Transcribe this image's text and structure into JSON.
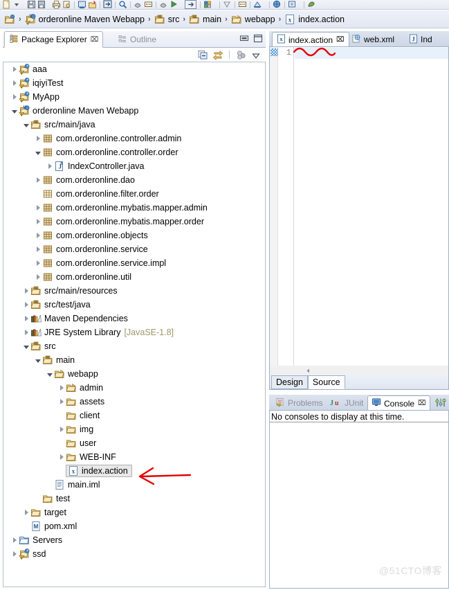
{
  "toolbar": {
    "icons": [
      "new-file-icon",
      "new-wizard-dropdown-icon",
      "save-icon",
      "save-dropdown-icon",
      "print-icon",
      "print-preview-icon",
      "build-all-icon",
      "search-icon",
      "debug-icon",
      "run-icon",
      "run-dropdown-icon",
      "external-tools-icon",
      "next-annotation-icon",
      "previous-annotation-icon",
      "open-type-icon",
      "open-task-icon",
      "perspective-icon",
      "new-java-project-icon",
      "toggle-breadcrumb-icon",
      "pin-editor-icon",
      "terminal-icon",
      "browser-icon",
      "snapshot-icon",
      "tomcat-icon"
    ]
  },
  "breadcrumb": {
    "items": [
      {
        "label": "",
        "icon": "workspace-root-icon"
      },
      {
        "label": "orderonline Maven Webapp",
        "icon": "maven-project-icon"
      },
      {
        "label": "src",
        "icon": "source-folder-icon"
      },
      {
        "label": "main",
        "icon": "source-folder-icon"
      },
      {
        "label": "webapp",
        "icon": "folder-icon"
      },
      {
        "label": "index.action",
        "icon": "xml-file-icon"
      }
    ],
    "separator": "›"
  },
  "package_explorer": {
    "tabs": [
      {
        "label": "Package Explorer",
        "icon": "package-explorer-icon",
        "active": true,
        "close": "⌧"
      },
      {
        "label": "Outline",
        "icon": "outline-icon",
        "active": false
      }
    ],
    "window_buttons": [
      {
        "name": "minimize-view-button",
        "glyph": "minimize"
      },
      {
        "name": "maximize-view-button",
        "glyph": "maximize"
      }
    ],
    "view_tools": [
      {
        "name": "collapse-all-icon"
      },
      {
        "name": "link-with-editor-icon"
      },
      {
        "name": "focus-on-active-task-icon"
      },
      {
        "name": "view-menu-icon"
      }
    ],
    "tree": [
      {
        "label": "aaa",
        "indent": 0,
        "arrow": "collapsed",
        "icon": "java-project-warning-icon"
      },
      {
        "label": "iqiyiTest",
        "indent": 0,
        "arrow": "collapsed",
        "icon": "java-project-warning-icon"
      },
      {
        "label": "MyApp",
        "indent": 0,
        "arrow": "collapsed",
        "icon": "java-project-warning-icon"
      },
      {
        "label": "orderonline Maven Webapp",
        "indent": 0,
        "arrow": "expanded",
        "icon": "maven-project-warning-icon"
      },
      {
        "label": "src/main/java",
        "indent": 1,
        "arrow": "expanded",
        "icon": "source-folder-icon"
      },
      {
        "label": "com.orderonline.controller.admin",
        "indent": 2,
        "arrow": "collapsed",
        "icon": "package-icon"
      },
      {
        "label": "com.orderonline.controller.order",
        "indent": 2,
        "arrow": "expanded",
        "icon": "package-icon"
      },
      {
        "label": "IndexController.java",
        "indent": 3,
        "arrow": "collapsed",
        "icon": "java-file-icon"
      },
      {
        "label": "com.orderonline.dao",
        "indent": 2,
        "arrow": "collapsed",
        "icon": "package-icon"
      },
      {
        "label": "com.orderonline.filter.order",
        "indent": 2,
        "arrow": "none",
        "icon": "package-empty-icon"
      },
      {
        "label": "com.orderonline.mybatis.mapper.admin",
        "indent": 2,
        "arrow": "collapsed",
        "icon": "package-icon"
      },
      {
        "label": "com.orderonline.mybatis.mapper.order",
        "indent": 2,
        "arrow": "collapsed",
        "icon": "package-icon"
      },
      {
        "label": "com.orderonline.objects",
        "indent": 2,
        "arrow": "collapsed",
        "icon": "package-icon"
      },
      {
        "label": "com.orderonline.service",
        "indent": 2,
        "arrow": "collapsed",
        "icon": "package-icon"
      },
      {
        "label": "com.orderonline.service.impl",
        "indent": 2,
        "arrow": "collapsed",
        "icon": "package-icon"
      },
      {
        "label": "com.orderonline.util",
        "indent": 2,
        "arrow": "collapsed",
        "icon": "package-icon"
      },
      {
        "label": "src/main/resources",
        "indent": 1,
        "arrow": "collapsed",
        "icon": "source-folder-icon"
      },
      {
        "label": "src/test/java",
        "indent": 1,
        "arrow": "collapsed",
        "icon": "source-folder-icon"
      },
      {
        "label": "Maven Dependencies",
        "indent": 1,
        "arrow": "collapsed",
        "icon": "library-icon"
      },
      {
        "label": "JRE System Library",
        "suffix": "[JavaSE-1.8]",
        "indent": 1,
        "arrow": "collapsed",
        "icon": "library-icon"
      },
      {
        "label": "src",
        "indent": 1,
        "arrow": "expanded",
        "icon": "source-folder-icon"
      },
      {
        "label": "main",
        "indent": 2,
        "arrow": "expanded",
        "icon": "source-folder-icon"
      },
      {
        "label": "webapp",
        "indent": 3,
        "arrow": "expanded",
        "icon": "folder-icon"
      },
      {
        "label": "admin",
        "indent": 4,
        "arrow": "collapsed",
        "icon": "folder-icon"
      },
      {
        "label": "assets",
        "indent": 4,
        "arrow": "collapsed",
        "icon": "folder-plain-icon"
      },
      {
        "label": "client",
        "indent": 4,
        "arrow": "none",
        "icon": "folder-plain-icon"
      },
      {
        "label": "img",
        "indent": 4,
        "arrow": "collapsed",
        "icon": "folder-plain-icon"
      },
      {
        "label": "user",
        "indent": 4,
        "arrow": "none",
        "icon": "folder-plain-icon"
      },
      {
        "label": "WEB-INF",
        "indent": 4,
        "arrow": "collapsed",
        "icon": "folder-plain-icon"
      },
      {
        "label": "index.action",
        "indent": 4,
        "arrow": "none",
        "icon": "xml-file-icon",
        "selected": true
      },
      {
        "label": "main.iml",
        "indent": 3,
        "arrow": "none",
        "icon": "text-file-icon"
      },
      {
        "label": "test",
        "indent": 2,
        "arrow": "none",
        "icon": "folder-plain-icon"
      },
      {
        "label": "target",
        "indent": 1,
        "arrow": "collapsed",
        "icon": "folder-plain-icon"
      },
      {
        "label": "pom.xml",
        "indent": 1,
        "arrow": "none",
        "icon": "maven-pom-icon"
      },
      {
        "label": "Servers",
        "indent": 0,
        "arrow": "collapsed",
        "icon": "folder-open-icon"
      },
      {
        "label": "ssd",
        "indent": 0,
        "arrow": "collapsed",
        "icon": "java-project-warning-icon"
      }
    ]
  },
  "editor": {
    "tabs": [
      {
        "label": "index.action",
        "icon": "xml-file-icon",
        "active": true,
        "close": "⌧"
      },
      {
        "label": "web.xml",
        "icon": "webxml-file-icon",
        "active": false
      },
      {
        "label": "Ind",
        "icon": "java-file-icon",
        "active": false
      }
    ],
    "line_numbers": [
      "1"
    ],
    "content": "",
    "bottom_tabs": [
      {
        "label": "Design",
        "active": false
      },
      {
        "label": "Source",
        "active": true
      }
    ]
  },
  "console": {
    "tabs": [
      {
        "label": "Problems",
        "icon": "problems-icon",
        "active": false
      },
      {
        "label": "JUnit",
        "icon": "junit-icon",
        "active": false
      },
      {
        "label": "Console",
        "icon": "console-icon",
        "active": true,
        "close": "⌧"
      }
    ],
    "message": "No consoles to display at this time.",
    "tool_icon": "console-preferences-icon"
  },
  "annotations": {
    "arrow_color": "#e60000",
    "squiggle_color": "#e60000"
  },
  "watermark": "@51CTO博客",
  "colors": {
    "accent": "#2f5fa8",
    "toolbar_bg": "#e6eaf3",
    "tab_active_bg": "#ffffff",
    "selection_bg": "#e8e8e8",
    "current_line_bg": "#e8f0fb",
    "library_suffix": "#9a9a6a"
  }
}
